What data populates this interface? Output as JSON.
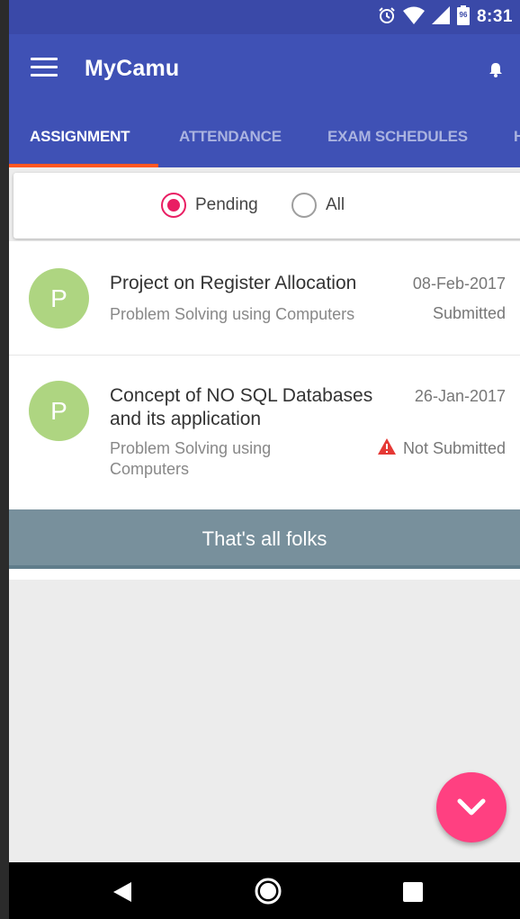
{
  "status_bar": {
    "time": "8:31",
    "battery_level": "96",
    "icons": [
      "alarm-icon",
      "wifi-icon",
      "signal-icon",
      "battery-icon"
    ]
  },
  "app_bar": {
    "title": "MyCamu",
    "icons": [
      "menu-icon",
      "bell-icon"
    ]
  },
  "tabs": [
    {
      "label": "ASSIGNMENT",
      "active": true
    },
    {
      "label": "ATTENDANCE",
      "active": false
    },
    {
      "label": "EXAM SCHEDULES",
      "active": false
    },
    {
      "label": "H",
      "active": false
    }
  ],
  "filter": {
    "options": [
      {
        "label": "Pending",
        "checked": true
      },
      {
        "label": "All",
        "checked": false
      }
    ]
  },
  "assignments": [
    {
      "avatar_letter": "P",
      "title_lines": [
        "Project on Register Allocation"
      ],
      "subject_lines": [
        "Problem Solving using Computers"
      ],
      "date": "08-Feb-2017",
      "status": "Submitted",
      "warning": false
    },
    {
      "avatar_letter": "P",
      "title_lines": [
        "Concept of NO SQL Databases",
        "and its application"
      ],
      "subject_lines": [
        "Problem Solving using",
        "Computers"
      ],
      "date": "26-Jan-2017",
      "status": "Not Submitted",
      "warning": true
    }
  ],
  "footer_text": "That's all folks",
  "colors": {
    "primary": "#3f51b5",
    "status_bar": "#3a49a8",
    "tab_indicator": "#ff5722",
    "radio_accent": "#e91e63",
    "avatar": "#aed581",
    "footer": "#78909c",
    "fab": "#ff4081",
    "warning": "#e53935"
  },
  "fab_icon": "chevron-down-icon",
  "nav_icons": [
    "back-icon",
    "home-icon",
    "recents-icon"
  ]
}
